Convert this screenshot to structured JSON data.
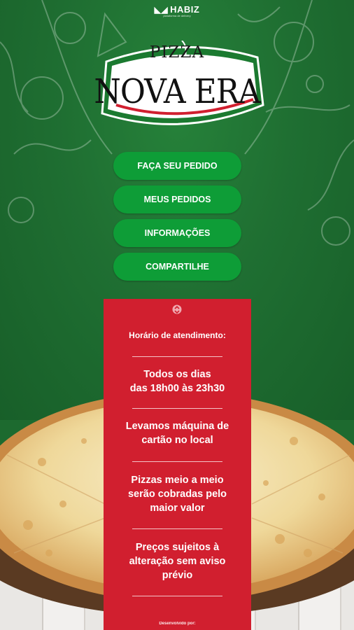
{
  "brand": {
    "name": "HABIZ",
    "tagline": "plataforma de delivery"
  },
  "logo": {
    "small_text": "PIZZA",
    "big_text": "NOVA ERA"
  },
  "menu": [
    {
      "label": "FAÇA SEU PEDIDO"
    },
    {
      "label": "MEUS PEDIDOS"
    },
    {
      "label": "INFORMAÇÕES"
    },
    {
      "label": "COMPARTILHE"
    }
  ],
  "info": {
    "title": "Horário de atendimento:",
    "schedule": [
      "Todos os dias",
      "das 18h00 às 23h30"
    ],
    "card": [
      "Levamos máquina de",
      "cartão no local"
    ],
    "halfhalf": [
      "Pizzas meio a meio",
      "serão cobradas pelo",
      "maior valor"
    ],
    "prices": [
      "Preços sujeitos à",
      "alteração sem aviso",
      "prévio"
    ],
    "developed_by": "Desenvolvido por:"
  },
  "colors": {
    "background_green": "#1f6f32",
    "button_green": "#0e9d37",
    "panel_red": "#d11f2f"
  }
}
